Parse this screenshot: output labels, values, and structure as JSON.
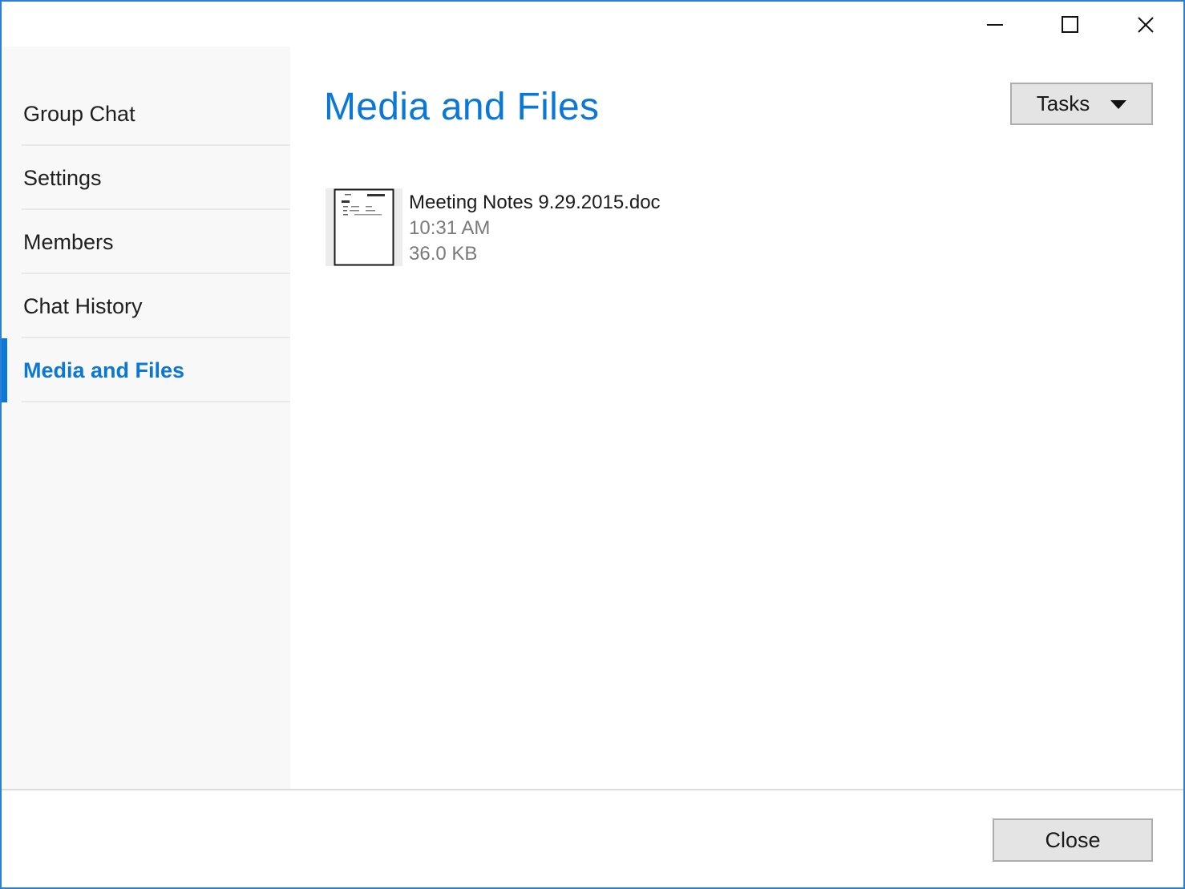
{
  "window": {
    "controls": [
      {
        "name": "minimize-button",
        "icon": "minimize-icon"
      },
      {
        "name": "maximize-button",
        "icon": "maximize-icon"
      },
      {
        "name": "close-window-button",
        "icon": "close-icon"
      }
    ]
  },
  "sidebar": {
    "items": [
      {
        "label": "Group Chat",
        "active": false
      },
      {
        "label": "Settings",
        "active": false
      },
      {
        "label": "Members",
        "active": false
      },
      {
        "label": "Chat History",
        "active": false
      },
      {
        "label": "Media and Files",
        "active": true
      }
    ]
  },
  "main": {
    "title": "Media and Files",
    "tasks_label": "Tasks",
    "files": [
      {
        "name": "Meeting Notes 9.29.2015.doc",
        "time": "10:31 AM",
        "size": "36.0 KB",
        "icon": "document-thumbnail-icon"
      }
    ]
  },
  "footer": {
    "close_label": "Close"
  },
  "colors": {
    "accent": "#0a78d4",
    "window_border": "#2b7fd6",
    "sidebar_bg": "#f8f8f8",
    "button_bg": "#e4e4e4",
    "secondary_text": "#7a7a7a"
  }
}
